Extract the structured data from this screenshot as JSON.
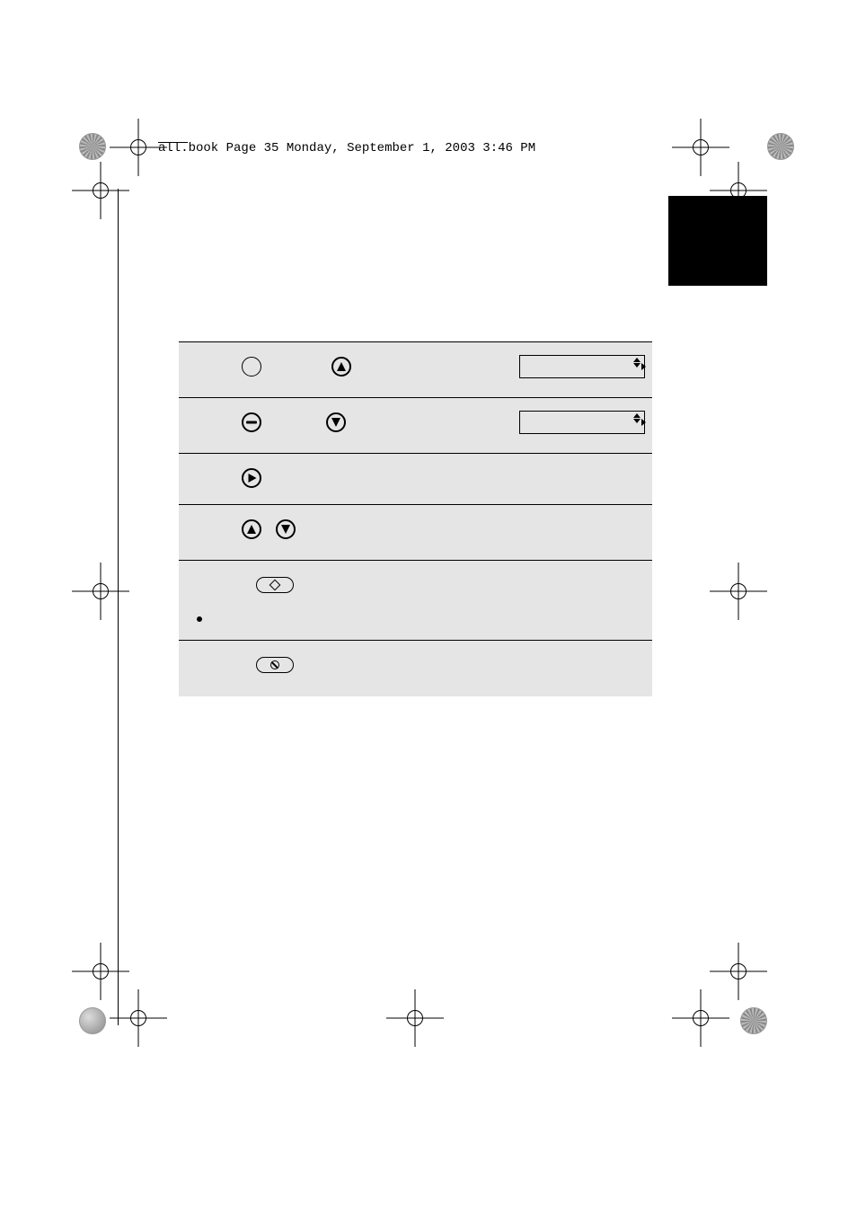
{
  "header": {
    "filename": "all.book",
    "page_label": "Page 35",
    "day": "Monday,",
    "date": "September 1, 2003",
    "time": "3:46 PM"
  },
  "steps": {
    "row1": {
      "icon1": "circle-outline",
      "icon2": "up-arrow-circle",
      "display": ""
    },
    "row2": {
      "icon1": "dash-circle",
      "icon2": "down-arrow-circle",
      "display": ""
    },
    "row3": {
      "icon1": "right-triangle-circle"
    },
    "row4": {
      "icon1": "up-arrow-circle",
      "icon2": "down-arrow-circle"
    },
    "row5": {
      "button": "start-diamond",
      "bullet_text": ""
    },
    "row6": {
      "button": "stop-circle"
    }
  }
}
